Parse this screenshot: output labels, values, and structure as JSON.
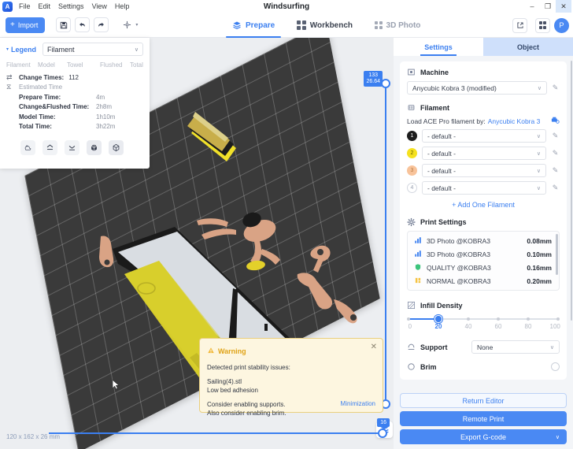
{
  "window": {
    "title": "Windsurfing",
    "logo": "A",
    "menus": [
      "File",
      "Edit",
      "Settings",
      "View",
      "Help"
    ],
    "controls": {
      "minimize": "–",
      "maximize": "❐",
      "close": "✕"
    }
  },
  "toolbar": {
    "import_label": "Import",
    "import_plus": "+",
    "icons": [
      {
        "name": "save-icon",
        "glyph": "💾"
      },
      {
        "name": "undo-icon",
        "glyph": "↶"
      },
      {
        "name": "redo-icon",
        "glyph": "↷"
      },
      {
        "name": "settings-gear-icon",
        "glyph": "⚙"
      }
    ],
    "caret": "▾",
    "tabs": [
      {
        "label": "Prepare",
        "active": true
      },
      {
        "label": "Workbench",
        "active": false
      },
      {
        "label": "3D Photo",
        "active": false
      }
    ],
    "right": {
      "share_icon": "↗",
      "apps_icon": "grid-icon",
      "avatar_initial": "P"
    }
  },
  "legend": {
    "title": "Legend",
    "caret": "▾",
    "select_value": "Filament",
    "select_caret": "∨",
    "columns": [
      "Filament",
      "Model",
      "Towel",
      "Flushed",
      "Total"
    ],
    "rows": [
      {
        "icon": "⇄",
        "key": "Change Times:",
        "value": "112",
        "muted": false
      },
      {
        "icon": "⧖",
        "key": "Estimated Time",
        "value": "",
        "muted": true
      },
      {
        "icon": "",
        "key": "Prepare Time:",
        "value": "4m",
        "muted": false
      },
      {
        "icon": "",
        "key": "Change&Flushed Time:",
        "value": "2h8m",
        "muted": false
      },
      {
        "icon": "",
        "key": "Model Time:",
        "value": "1h10m",
        "muted": false
      },
      {
        "icon": "",
        "key": "Total Time:",
        "value": "3h22m",
        "muted": false
      }
    ],
    "buttons": [
      {
        "name": "nozzle-tool-icon",
        "glyph": "⚒"
      },
      {
        "name": "move-up-icon",
        "glyph": "⌃"
      },
      {
        "name": "move-down-icon",
        "glyph": "⌄"
      },
      {
        "name": "cube-filled-icon",
        "glyph": "⬢"
      },
      {
        "name": "cube-outline-icon",
        "glyph": "⬡"
      }
    ]
  },
  "viewport": {
    "dimensions": "120 x 162 x 26 mm",
    "vertical_slider": {
      "top_label_line1": "133",
      "top_label_line2": "26.64"
    },
    "horizontal_slider": {
      "label": "16"
    },
    "layer_view_icon": "layers-icon"
  },
  "warning": {
    "icon": "⚠",
    "title": "Warning",
    "close": "✕",
    "line1": "Detected print stability issues:",
    "file": "Sailing(4).stl",
    "issue": "Low bed adhesion",
    "advice1": "Consider enabling supports.",
    "advice2": "Also consider enabling brim.",
    "link": "Minimization"
  },
  "right_panel": {
    "tabs": [
      {
        "label": "Settings",
        "active": true
      },
      {
        "label": "Object",
        "active": false
      }
    ],
    "machine": {
      "section_title": "Machine",
      "icon": "printer-icon",
      "value": "Anycubic Kobra 3 (modified)",
      "caret": "∨",
      "edit_icon": "✎"
    },
    "filament": {
      "section_title": "Filament",
      "icon": "spool-icon",
      "load_text": "Load ACE Pro filament by:",
      "load_link": "Anycubic Kobra 3",
      "printer_icon": "🖨",
      "slots": [
        {
          "index": "1",
          "color": "#1d1d1d",
          "text_color": "#ffffff",
          "value": "- default -"
        },
        {
          "index": "2",
          "color": "#f5e11e",
          "text_color": "#6b6200",
          "value": "- default -"
        },
        {
          "index": "3",
          "color": "#f8c39a",
          "text_color": "#b87b46",
          "value": "- default -"
        },
        {
          "index": "4",
          "color": "#ffffff",
          "text_color": "#98a0b0",
          "value": "- default -"
        }
      ],
      "add_label": "+ Add One Filament",
      "caret": "∨",
      "edit_icon": "✎"
    },
    "print_settings": {
      "section_title": "Print Settings",
      "icon": "gear-icon",
      "profiles": [
        {
          "icon": "chart-icon",
          "icon_color": "#3b7ff0",
          "name": "3D Photo @KOBRA3",
          "value": "0.08mm"
        },
        {
          "icon": "chart-icon",
          "icon_color": "#3b7ff0",
          "name": "3D Photo @KOBRA3",
          "value": "0.10mm"
        },
        {
          "icon": "shield-icon",
          "icon_color": "#3cc47c",
          "name": "QUALITY @KOBRA3",
          "value": "0.16mm"
        },
        {
          "icon": "bars-icon",
          "icon_color": "#f5c343",
          "name": "NORMAL @KOBRA3",
          "value": "0.20mm"
        }
      ]
    },
    "infill": {
      "section_title": "Infill Density",
      "icon": "hatch-icon",
      "value": 20,
      "ticks": [
        "0",
        "20",
        "40",
        "60",
        "80",
        "100"
      ]
    },
    "support": {
      "label": "Support",
      "icon": "support-icon",
      "value": "None",
      "caret": "∨"
    },
    "brim": {
      "label": "Brim",
      "icon": "brim-icon",
      "checked": false
    },
    "footer_buttons": [
      {
        "label": "Return Editor",
        "style": "ghost",
        "caret": ""
      },
      {
        "label": "Remote Print",
        "style": "primary",
        "caret": ""
      },
      {
        "label": "Export G-code",
        "style": "primary",
        "caret": "∨"
      }
    ]
  },
  "colors": {
    "accent": "#3b7ff0",
    "primary_button": "#4a89f3",
    "warning": "#e0a316",
    "warning_bg": "#fdf6e0",
    "bed": "#3a3a3a",
    "viewport_bg": "#eceef1",
    "panel_bg": "#f3f5f8"
  }
}
